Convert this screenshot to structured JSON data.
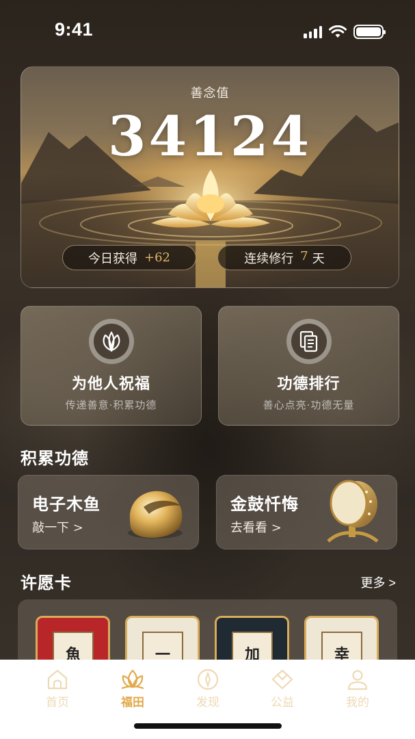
{
  "status_bar": {
    "time": "9:41",
    "icons": [
      "cellular-signal-icon",
      "wifi-icon",
      "battery-icon"
    ]
  },
  "hero": {
    "label": "善念值",
    "value": "34124",
    "today_label": "今日获得",
    "today_value": "+62",
    "streak_label": "连续修行",
    "streak_value": "7",
    "streak_unit": "天"
  },
  "features": [
    {
      "title": "为他人祝福",
      "subtitle": "传递善意·积累功德",
      "icon": "blessing-leaves-icon"
    },
    {
      "title": "功德排行",
      "subtitle": "善心点亮·功德无量",
      "icon": "ranking-documents-icon"
    }
  ],
  "merit_section": {
    "title": "积累功德"
  },
  "tools": [
    {
      "title": "电子木鱼",
      "action": "敲一下 >",
      "image": "golden-wooden-fish"
    },
    {
      "title": "金鼓忏悔",
      "action": "去看看 >",
      "image": "golden-drum"
    }
  ],
  "wish_section": {
    "title": "许愿卡",
    "more": "更多 >"
  },
  "wish_cards": [
    {
      "char": "魚",
      "bg": "#b8262a"
    },
    {
      "char": "一",
      "bg": "#efe7d6"
    },
    {
      "char": "加",
      "bg": "#1f2a33"
    },
    {
      "char": "幸",
      "bg": "#efe7d6"
    }
  ],
  "tabbar": {
    "active": "福田",
    "items": [
      {
        "label": "首页",
        "icon": "home-icon"
      },
      {
        "label": "福田",
        "icon": "lotus-icon"
      },
      {
        "label": "发现",
        "icon": "compass-icon"
      },
      {
        "label": "公益",
        "icon": "charity-hands-icon"
      },
      {
        "label": "我的",
        "icon": "profile-icon"
      }
    ]
  },
  "colors": {
    "accent": "#e1a94a",
    "gold_text": "#e0b768",
    "inactive_tab": "#eed9b4"
  }
}
